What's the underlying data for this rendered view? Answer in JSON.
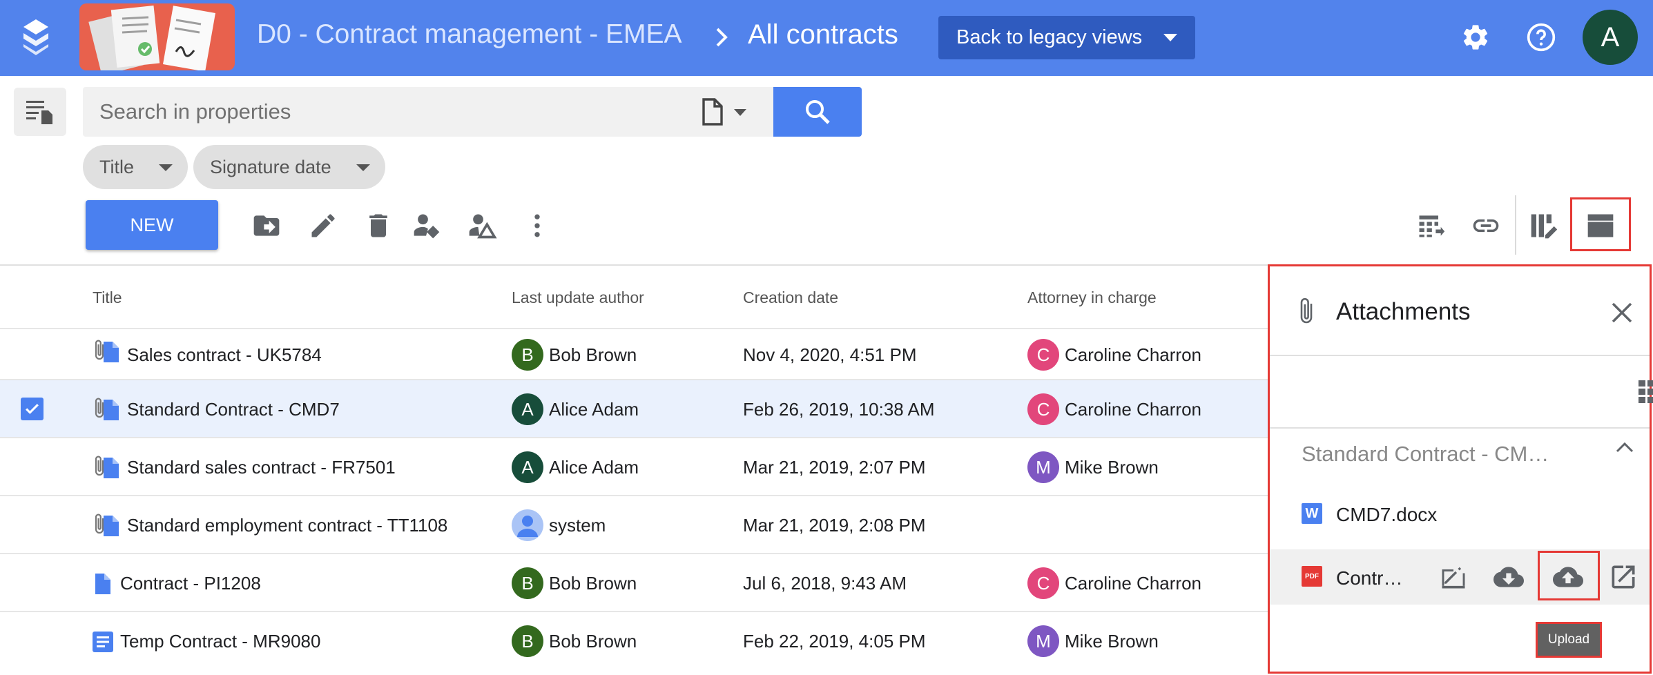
{
  "header": {
    "workspace": "D0 - Contract management - EMEA",
    "separator": ">",
    "title": "All contracts",
    "legacy_button": "Back to legacy views",
    "user_initial": "A",
    "colors": {
      "bar": "#5283ec",
      "legacy_button": "#2f5bbf",
      "avatar": "#174d3a",
      "banner": "#e8614d"
    }
  },
  "search": {
    "placeholder": "Search in properties",
    "value": "",
    "doctype_icon": "document-icon"
  },
  "filters": [
    {
      "label": "Title"
    },
    {
      "label": "Signature date"
    }
  ],
  "toolbar": {
    "new_label": "NEW",
    "icons": [
      "move-to-folder-icon",
      "edit-icon",
      "delete-icon",
      "assign-user-icon",
      "share-user-icon",
      "more-vert-icon"
    ],
    "right_icons": [
      "export-table-icon",
      "link-icon",
      "edit-columns-icon",
      "side-panel-icon"
    ]
  },
  "table": {
    "columns": [
      "Title",
      "Last update author",
      "Creation date",
      "Attorney in charge"
    ],
    "rows": [
      {
        "title": "Sales contract - UK5784",
        "has_attachment": true,
        "selected": false,
        "author": "Bob Brown",
        "author_initial": "B",
        "author_color": "#33691e",
        "created": "Nov 4, 2020, 4:51 PM",
        "attorney": "Caroline Charron",
        "attorney_initial": "C",
        "attorney_color": "#e2467b",
        "doc_style": "file"
      },
      {
        "title": "Standard Contract - CMD7",
        "has_attachment": true,
        "selected": true,
        "author": "Alice Adam",
        "author_initial": "A",
        "author_color": "#174d3a",
        "created": "Feb 26, 2019, 10:38 AM",
        "attorney": "Caroline Charron",
        "attorney_initial": "C",
        "attorney_color": "#e2467b",
        "doc_style": "file"
      },
      {
        "title": "Standard sales contract - FR7501",
        "has_attachment": true,
        "selected": false,
        "author": "Alice Adam",
        "author_initial": "A",
        "author_color": "#174d3a",
        "created": "Mar 21, 2019, 2:07 PM",
        "attorney": "Mike Brown",
        "attorney_initial": "M",
        "attorney_color": "#7e57c2",
        "doc_style": "file"
      },
      {
        "title": "Standard employment contract - TT1108",
        "has_attachment": true,
        "selected": false,
        "author": "system",
        "author_initial": "",
        "author_color": "#aac4f6",
        "created": "Mar 21, 2019, 2:08 PM",
        "attorney": "",
        "attorney_initial": "",
        "attorney_color": "",
        "doc_style": "file"
      },
      {
        "title": "Contract - PI1208",
        "has_attachment": false,
        "selected": false,
        "author": "Bob Brown",
        "author_initial": "B",
        "author_color": "#33691e",
        "created": "Jul 6, 2018, 9:43 AM",
        "attorney": "Caroline Charron",
        "attorney_initial": "C",
        "attorney_color": "#e2467b",
        "doc_style": "file"
      },
      {
        "title": "Temp Contract - MR9080",
        "has_attachment": false,
        "selected": false,
        "author": "Bob Brown",
        "author_initial": "B",
        "author_color": "#33691e",
        "created": "Feb 22, 2019, 4:05 PM",
        "attorney": "Mike Brown",
        "attorney_initial": "M",
        "attorney_color": "#7e57c2",
        "doc_style": "note"
      }
    ]
  },
  "attachments": {
    "title": "Attachments",
    "group_title": "Standard Contract - CM…",
    "files": [
      {
        "name": "CMD7.docx",
        "badge": "W",
        "badge_color": "#4a80f0"
      },
      {
        "name": "Contr…",
        "badge": "PDF",
        "badge_color": "#e53935"
      }
    ],
    "file_actions": [
      "annotate-icon",
      "download-icon",
      "upload-icon",
      "open-external-icon"
    ],
    "tooltip": "Upload",
    "highlight_color": "#e53935"
  }
}
